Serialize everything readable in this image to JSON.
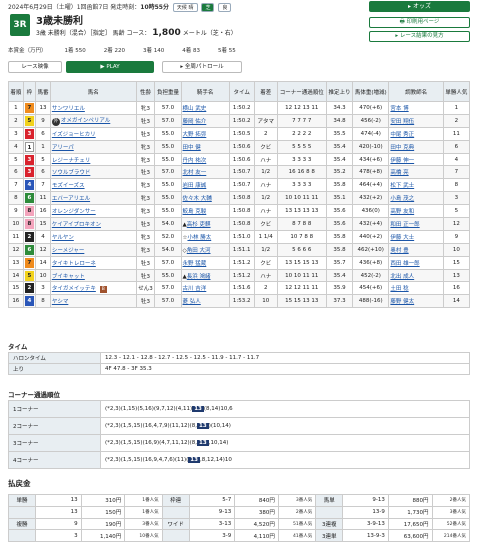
{
  "header": {
    "date": "2024年6月29日（土曜）1回函館7日 発走時刻：",
    "post_time": "10時55分",
    "weather_label": "天候",
    "weather": "晴",
    "track_label": "芝",
    "going": "良",
    "race_no": "3R",
    "title": "3歳未勝利",
    "cond": "3歳 未勝利（混合）［指定］ 馬齢 コース：",
    "distance": "1,800",
    "dist_unit": "メートル（芝・右）",
    "money": [
      "本賞金（万円）",
      "1着 550",
      "2着 220",
      "3着 140",
      "4着 83",
      "5着 55"
    ]
  },
  "buttons": {
    "odds": "オッズ",
    "print": "印刷用ページ",
    "results": "レース結果の見方",
    "video": "レース映像",
    "play": "PLAY",
    "patrol": "全周パトロール"
  },
  "cols": [
    "着順",
    "枠",
    "馬番",
    "馬名",
    "性齢",
    "負担重量",
    "騎手名",
    "タイム",
    "着差",
    "コーナー通過順位",
    "推定上り",
    "馬体重(増減)",
    "調教師名",
    "単勝人気"
  ],
  "rows": [
    [
      "1",
      "7",
      "13",
      "サンワリエル",
      "牝3",
      "57.0",
      "横山 武史",
      "1:50.2",
      "",
      "12 12 13 11",
      "34.3",
      "470(+6)",
      "宮本 博",
      "1"
    ],
    [
      "2",
      "5",
      "9",
      "オメガインペリアル",
      "牡3",
      "57.0",
      "藤岡 佑介",
      "1:50.2",
      "アタマ",
      "7 7 7 7",
      "34.8",
      "456(-2)",
      "安田 翔伍",
      "2"
    ],
    [
      "3",
      "3",
      "6",
      "イズジョーヒカリ",
      "牡3",
      "55.0",
      "大野 拓弥",
      "1:50.5",
      "2",
      "2 2 2 2",
      "35.5",
      "474(-4)",
      "中尾 秀正",
      "11"
    ],
    [
      "4",
      "1",
      "1",
      "アリーパ",
      "牝3",
      "55.0",
      "田中 健",
      "1:50.6",
      "クビ",
      "5 5 5 5",
      "35.4",
      "420(-10)",
      "田中 克典",
      "6"
    ],
    [
      "5",
      "3",
      "5",
      "レジーナチェリ",
      "牝3",
      "55.0",
      "丹内 祐次",
      "1:50.6",
      "ハナ",
      "3 3 3 3",
      "35.4",
      "434(+6)",
      "伊藤 伸一",
      "4"
    ],
    [
      "6",
      "3",
      "6",
      "ソウルブラウド",
      "牡3",
      "57.0",
      "北村 友一",
      "1:50.7",
      "1/2",
      "16 16 8 8",
      "35.2",
      "478(+8)",
      "高橋 亮",
      "7"
    ],
    [
      "7",
      "4",
      "7",
      "モズイーズス",
      "牝3",
      "55.0",
      "岩田 康誠",
      "1:50.7",
      "ハナ",
      "3 3 3 3",
      "35.8",
      "464(+4)",
      "松下 武士",
      "8"
    ],
    [
      "8",
      "6",
      "11",
      "エバーアリエル",
      "牝3",
      "55.0",
      "佐々木 大輔",
      "1:50.8",
      "1/2",
      "10 10 11 11",
      "35.1",
      "432(+2)",
      "小島 茂之",
      "3"
    ],
    [
      "9",
      "8",
      "16",
      "オレンジダンサー",
      "牝3",
      "55.0",
      "鮫島 克駿",
      "1:50.8",
      "ハナ",
      "13 13 13 13",
      "35.6",
      "436(0)",
      "高野 友和",
      "5"
    ],
    [
      "10",
      "8",
      "15",
      "ケイアイプロキオン",
      "牡3",
      "54.0",
      "高杉 吏麒",
      "1:50.8",
      "クビ",
      "8 7 8 8",
      "35.6",
      "432(+4)",
      "和田 正一郎",
      "12"
    ],
    [
      "11",
      "2",
      "4",
      "ヤルヤン",
      "牝3",
      "52.0",
      "小林 勝太",
      "1:51.0",
      "1 1/4",
      "10 7 8 8",
      "35.8",
      "440(+2)",
      "伊藤 大士",
      "9"
    ],
    [
      "12",
      "6",
      "12",
      "シーメジャー",
      "牝3",
      "54.0",
      "角田 大河",
      "1:51.1",
      "1/2",
      "5 6 6 6",
      "35.8",
      "462(+10)",
      "奥村 豊",
      "10"
    ],
    [
      "13",
      "7",
      "14",
      "タイキトレローネ",
      "牡3",
      "57.0",
      "永野 猛蔵",
      "1:51.2",
      "クビ",
      "13 15 15 13",
      "35.7",
      "436(+8)",
      "西田 雄一郎",
      "15"
    ],
    [
      "14",
      "5",
      "10",
      "ブイキャット",
      "牡3",
      "55.0",
      "長浜 鴻緒",
      "1:51.2",
      "ハナ",
      "10 10 11 11",
      "35.4",
      "452(-2)",
      "北出 成人",
      "13"
    ],
    [
      "15",
      "2",
      "3",
      "タイガメイッテキ",
      "せん3",
      "57.0",
      "古川 吉洋",
      "1:51.6",
      "2",
      "12 12 11 11",
      "35.9",
      "454(+6)",
      "土田 稔",
      "16"
    ],
    [
      "16",
      "4",
      "8",
      "ヤシマ",
      "牡3",
      "57.0",
      "菱 弘人",
      "1:53.2",
      "10",
      "15 15 13 13",
      "37.3",
      "488(-16)",
      "藤野 健太",
      "14"
    ]
  ],
  "laps": {
    "heading": "タイム",
    "label1": "ハロンタイム",
    "val1": "12.3 - 12.1 - 12.8 - 12.7 - 12.5 - 12.5 - 11.9 - 11.7 - 11.7",
    "label2": "上り",
    "val2": "4F 47.8 - 3F 35.3"
  },
  "corner": {
    "heading": "コーナー通過順位",
    "rows": [
      {
        "label": "1コーナー",
        "pre": "(*2,3)(1,15)(5,16)(9,7,12)(4,11)",
        "hl": "13",
        "post": "(8,14)10,6"
      },
      {
        "label": "2コーナー",
        "pre": "(*2,3)(1,5,15)(16,4,7,9)(11,12)(8,",
        "hl": "13",
        "post": ")(10,14)"
      },
      {
        "label": "3コーナー",
        "pre": "(*2,3)(1,5,15)(16,9)(4,7,11,12)(8,",
        "hl": "13",
        "post": ",10,14)"
      },
      {
        "label": "4コーナー",
        "pre": "(*2,3)(1,5,15)(16,9,4,7,6)(11)(",
        "hl": "13",
        "post": ",8,12,14)10"
      }
    ]
  },
  "payout": {
    "heading": "払戻金",
    "rows": [
      [
        "単勝",
        "13",
        "310円",
        "1番人気",
        "枠連",
        "5-7",
        "840円",
        "3番人気",
        "馬単",
        "9-13",
        "880円",
        "2番人気"
      ],
      [
        "",
        "13",
        "150円",
        "1番人気",
        "",
        "9-13",
        "380円",
        "2番人気",
        "",
        "13-9",
        "1,730円",
        "3番人気"
      ],
      [
        "複勝",
        "9",
        "190円",
        "3番人気",
        "ワイド",
        "3-13",
        "4,520円",
        "51番人気",
        "3連複",
        "3-9-13",
        "17,650円",
        "52番人気"
      ],
      [
        "",
        "3",
        "1,140円",
        "10番人気",
        "",
        "3-9",
        "4,110円",
        "41番人気",
        "3連単",
        "13-9-3",
        "63,600円",
        "214番人気"
      ]
    ]
  },
  "colors": {
    "green": "#1a7a3d",
    "navy": "#1f3a6e"
  }
}
